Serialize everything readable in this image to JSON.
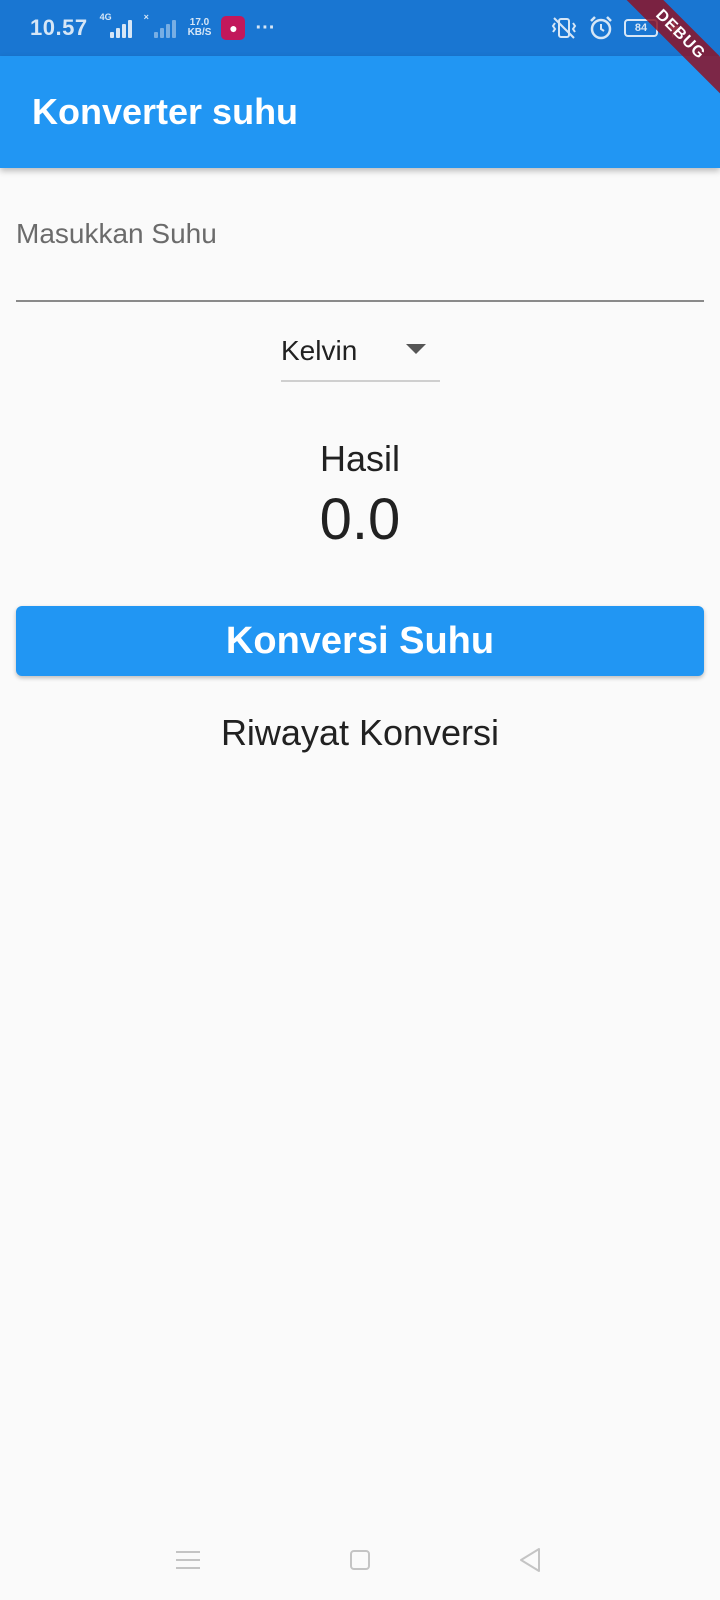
{
  "status_bar": {
    "time": "10.57",
    "network_type": "4G",
    "net_speed_value": "17.0",
    "net_speed_unit": "KB/S",
    "more": "···",
    "battery": "84"
  },
  "debug_banner": "DEBUG",
  "app_bar": {
    "title": "Konverter suhu"
  },
  "form": {
    "input_placeholder": "Masukkan Suhu",
    "input_value": "",
    "dropdown_selected": "Kelvin"
  },
  "result": {
    "label": "Hasil",
    "value": "0.0"
  },
  "actions": {
    "convert_label": "Konversi Suhu"
  },
  "history": {
    "title": "Riwayat Konversi"
  },
  "colors": {
    "primary": "#2196f3",
    "status_bar": "#1976d2",
    "background": "#fafafa"
  }
}
